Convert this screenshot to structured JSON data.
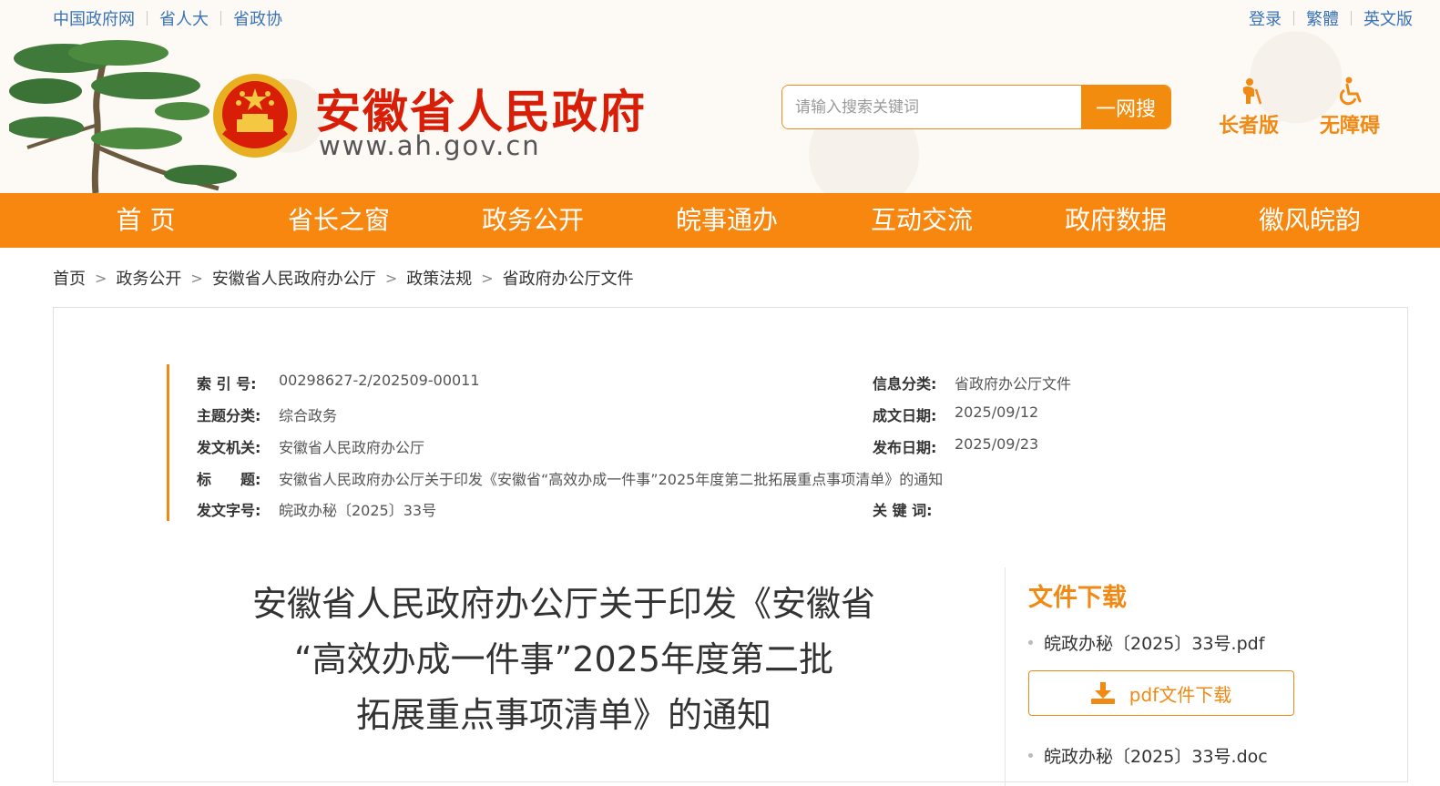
{
  "header": {
    "top_links_left": [
      "中国政府网",
      "省人大",
      "省政协"
    ],
    "top_links_right": [
      "登录",
      "繁體",
      "英文版"
    ],
    "site_title": "安徽省人民政府",
    "site_url": "www.ah.gov.cn",
    "search": {
      "placeholder": "请输入搜索关键词",
      "button_label": "一网搜"
    },
    "modes": {
      "elder": "长者版",
      "accessible": "无障碍"
    }
  },
  "nav": [
    "首 页",
    "省长之窗",
    "政务公开",
    "皖事通办",
    "互动交流",
    "政府数据",
    "徽风皖韵"
  ],
  "breadcrumb": [
    "首页",
    "政务公开",
    "安徽省人民政府办公厅",
    "政策法规",
    "省政府办公厅文件"
  ],
  "meta": {
    "index_label": "索 引 号:",
    "index_value": "00298627-2/202509-00011",
    "category_label": "信息分类:",
    "category_value": "省政府办公厅文件",
    "theme_label": "主题分类:",
    "theme_value": "综合政务",
    "written_label": "成文日期:",
    "written_value": "2025/09/12",
    "issuer_label": "发文机关:",
    "issuer_value": "安徽省人民政府办公厅",
    "published_label": "发布日期:",
    "published_value": "2025/09/23",
    "title_label": "标　　题:",
    "title_value": "安徽省人民政府办公厅关于印发《安徽省“高效办成一件事”2025年度第二批拓展重点事项清单》的通知",
    "docno_label": "发文字号:",
    "docno_value": "皖政办秘〔2025〕33号",
    "keywords_label": "关 键 词:",
    "keywords_value": ""
  },
  "article": {
    "title_lines": [
      "安徽省人民政府办公厅关于印发《安徽省",
      "“高效办成一件事”2025年度第二批",
      "拓展重点事项清单》的通知"
    ]
  },
  "download": {
    "title": "文件下载",
    "file_name": "皖政办秘〔2025〕33号.pdf",
    "button_label": "pdf文件下载",
    "file_name_2": "皖政办秘〔2025〕33号.doc"
  },
  "colors": {
    "accent": "#f7870f",
    "brand_red": "#d81e06",
    "link_blue": "#3a73b8"
  }
}
